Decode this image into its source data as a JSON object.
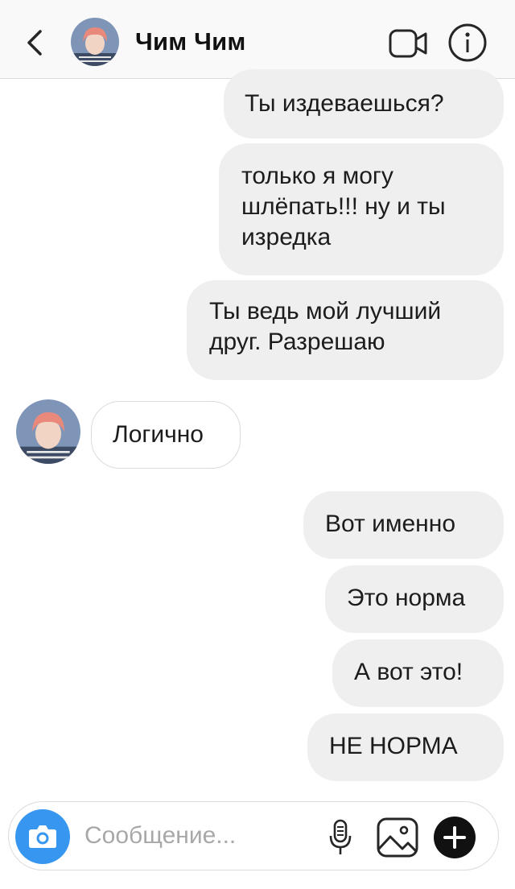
{
  "header": {
    "username": "Чим Чим"
  },
  "messages": [
    {
      "direction": "outgoing",
      "text": "Ты издеваешься?"
    },
    {
      "direction": "outgoing",
      "lines": [
        "только я могу",
        "шлёпать!!! ну и ты",
        "изредка"
      ]
    },
    {
      "direction": "outgoing",
      "lines": [
        "Ты ведь мой лучший",
        "друг. Разрешаю"
      ]
    },
    {
      "direction": "incoming",
      "text": "Логично"
    },
    {
      "direction": "outgoing",
      "text": "Вот именно"
    },
    {
      "direction": "outgoing",
      "text": "Это норма"
    },
    {
      "direction": "outgoing",
      "text": "А вот это!"
    },
    {
      "direction": "outgoing",
      "text": "НЕ НОРМА"
    }
  ],
  "composer": {
    "placeholder": "Сообщение...",
    "value": ""
  },
  "icons": {
    "back": "chevron-left-icon",
    "video": "video-camera-icon",
    "info": "info-icon",
    "camera": "camera-icon",
    "mic": "microphone-icon",
    "gallery": "image-icon",
    "plus": "plus-icon"
  },
  "colors": {
    "outgoing_bubble": "#efefef",
    "incoming_bubble": "#ffffff",
    "camera_button": "#3797f0"
  }
}
